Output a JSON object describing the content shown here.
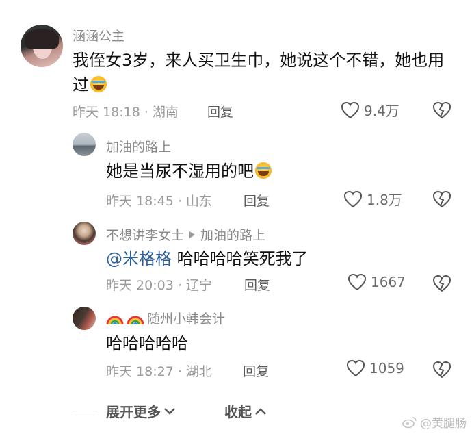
{
  "comments": [
    {
      "user": "涵涵公主",
      "text": "我侄女3岁，来人买卫生巾，她说这个不错，她也用过",
      "time": "昨天 18:18 · 湖南",
      "reply_label": "回复",
      "likes": "9.4万"
    },
    {
      "user": "加油的路上",
      "text": "她是当尿不湿用的吧",
      "time": "昨天 18:45 · 山东",
      "reply_label": "回复",
      "likes": "1.8万"
    },
    {
      "user": "不想讲李女士",
      "reply_to": "加油的路上",
      "mention": "@米格格",
      "text": "哈哈哈哈笑死我了",
      "time": "昨天 20:03 · 辽宁",
      "reply_label": "回复",
      "likes": "1667"
    },
    {
      "user": "随州小韩会计",
      "text": "哈哈哈哈哈",
      "time": "昨天 18:27 · 湖北",
      "reply_label": "回复",
      "likes": "1059"
    }
  ],
  "footer": {
    "expand_label": "展开更多",
    "collapse_label": "收起"
  },
  "watermark": "@黄腿肠",
  "colors": {
    "mention": "#2d5f9a",
    "heart_stroke": "#555555",
    "text": "#111111",
    "meta": "#9a9a9a"
  },
  "icons": [
    "heart-icon",
    "broken-heart-icon",
    "chevron-down-icon",
    "chevron-up-icon",
    "triangle-right-icon",
    "laughing-emoji-icon",
    "rainbow-icon",
    "weibo-logo-icon"
  ]
}
